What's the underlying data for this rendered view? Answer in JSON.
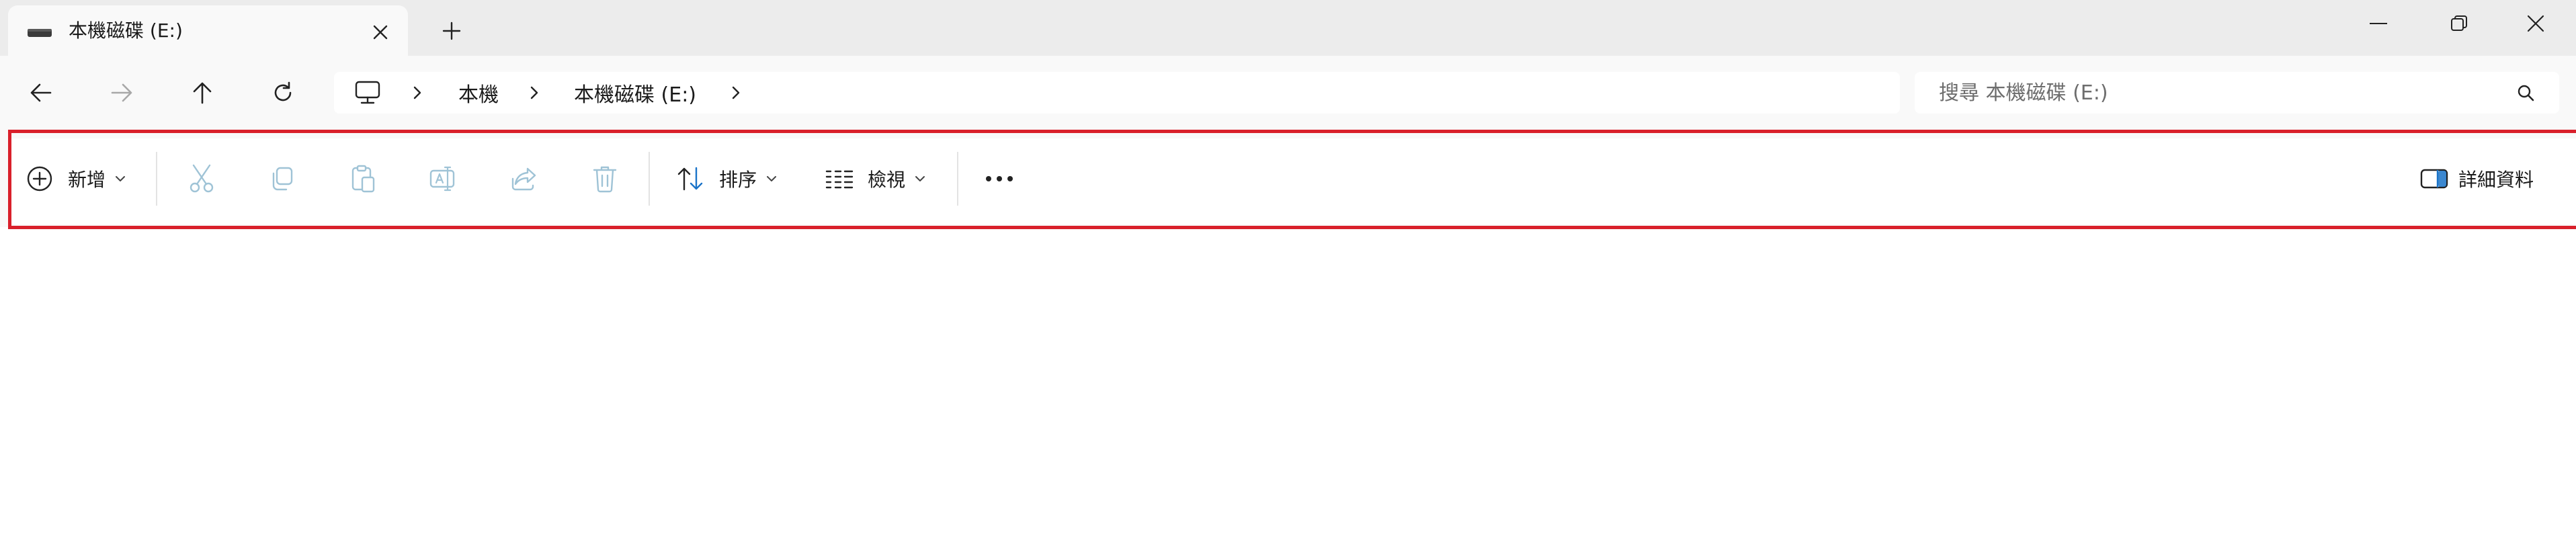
{
  "tab": {
    "title": "本機磁碟 (E:)",
    "icon": "drive-icon"
  },
  "window_controls": [
    "minimize-icon",
    "restore-icon",
    "close-icon"
  ],
  "navigation": {
    "buttons": [
      "back-arrow-icon",
      "forward-arrow-icon",
      "up-arrow-icon",
      "refresh-icon"
    ]
  },
  "address_bar": {
    "root_icon": "computer-icon",
    "breadcrumbs": [
      "本機",
      "本機磁碟 (E:)"
    ]
  },
  "search": {
    "placeholder": "搜尋 本機磁碟 (E:)",
    "icon": "search-icon"
  },
  "toolbar": {
    "new_label": "新增",
    "action_icons": [
      "cut-icon",
      "copy-icon",
      "paste-icon",
      "rename-icon",
      "share-icon",
      "delete-icon"
    ],
    "sort_label": "排序",
    "view_label": "檢視",
    "more_icon": "more-icon",
    "details_label": "詳細資料",
    "highlight_color": "#d9202b"
  }
}
